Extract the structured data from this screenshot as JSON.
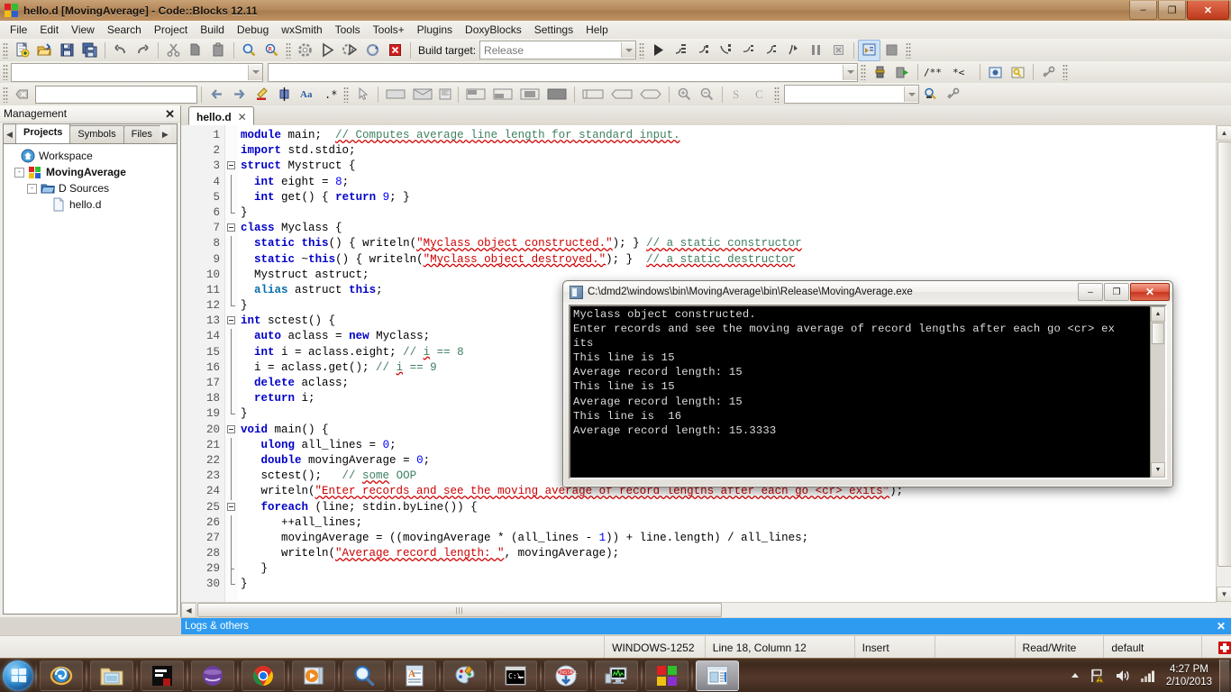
{
  "titlebar": {
    "title": "hello.d [MovingAverage] - Code::Blocks 12.11",
    "minimize": "–",
    "restore": "❐",
    "close": "✕"
  },
  "menubar": {
    "items": [
      "File",
      "Edit",
      "View",
      "Search",
      "Project",
      "Build",
      "Debug",
      "wxSmith",
      "Tools",
      "Tools+",
      "Plugins",
      "DoxyBlocks",
      "Settings",
      "Help"
    ]
  },
  "toolbar": {
    "build_target_label": "Build target:",
    "build_target_value": "Release",
    "main_icons": [
      "new-file-icon",
      "open-file-icon",
      "save-icon",
      "save-all-icon",
      "undo-icon",
      "redo-icon",
      "cut-icon",
      "copy-icon",
      "paste-icon",
      "find-icon",
      "replace-icon"
    ],
    "compile_icons": [
      "build-icon",
      "run-icon",
      "build-and-run-icon",
      "rebuild-icon",
      "abort-icon"
    ],
    "debug_icons": [
      "debug-continue-icon",
      "next-line-icon",
      "step-into-icon",
      "step-out-icon",
      "next-instruction-icon",
      "step-into-instruction-icon",
      "run-to-cursor-icon",
      "break-debugger-icon",
      "stop-debugger-icon",
      "debugging-windows-icon",
      "various-info-icon"
    ],
    "doxy_icons": [
      "doxyblocks-extract-icon",
      "doxyblocks-run-icon",
      "doxyblocks-comment-icon",
      "doxyblocks-block-comment-icon",
      "doxyblocks-preview-icon",
      "doxyblocks-help-icon",
      "doxyblocks-config-icon"
    ],
    "find_placeholder": "",
    "goto_placeholder": "",
    "search_icons": [
      "clear-icon",
      "prev-match-icon",
      "next-match-icon",
      "highlight-icon",
      "select-icon",
      "match-case-icon",
      "regex-icon"
    ],
    "wxsmith_icons": [
      "pointer-icon",
      "panel-icon",
      "dialog-icon",
      "frame-icon",
      "align-left-icon",
      "align-right-icon",
      "align-center-icon",
      "fill-icon",
      "expand-icon",
      "shrink-icon",
      "stretch-icon",
      "zoom-in-icon",
      "zoom-out-icon",
      "s-icon",
      "c-icon"
    ],
    "symbol_placeholder": ""
  },
  "management": {
    "title": "Management",
    "close": "✕",
    "tabs": [
      {
        "label": "Projects",
        "active": true
      },
      {
        "label": "Symbols",
        "active": false
      },
      {
        "label": "Files",
        "active": false
      }
    ],
    "prev_arrow": "◀",
    "next_arrow": "▶",
    "tree": [
      {
        "label": "Workspace",
        "indent": 0,
        "icon": "workspace-icon",
        "bold": false,
        "expander": ""
      },
      {
        "label": "MovingAverage",
        "indent": 1,
        "icon": "project-icon",
        "bold": true,
        "expander": "-"
      },
      {
        "label": "D Sources",
        "indent": 2,
        "icon": "folder-icon",
        "bold": false,
        "expander": "-"
      },
      {
        "label": "hello.d",
        "indent": 3,
        "icon": "file-icon",
        "bold": false,
        "expander": ""
      }
    ]
  },
  "editor": {
    "tab_label": "hello.d",
    "tab_close": "✕",
    "total_lines": 30,
    "code": [
      {
        "n": 1,
        "fold": "none",
        "html": "<span class=\"kw\">module</span> <span class=\"pln\">main;  </span><span class=\"cmt sq\">// Computes average line length for standard input.</span>"
      },
      {
        "n": 2,
        "fold": "none",
        "html": "<span class=\"kw\">import</span> <span class=\"pln\">std.stdio;</span>"
      },
      {
        "n": 3,
        "fold": "open",
        "html": "<span class=\"kw\">struct</span> <span class=\"pln\">Mystruct {</span>"
      },
      {
        "n": 4,
        "fold": "bar",
        "html": "  <span class=\"kw\">int</span> <span class=\"pln\">eight = </span><span class=\"num\">8</span><span class=\"pln\">;</span>"
      },
      {
        "n": 5,
        "fold": "bar",
        "html": "  <span class=\"kw\">int</span> <span class=\"pln\">get() { </span><span class=\"kw\">return</span> <span class=\"num\">9</span><span class=\"pln\">; }</span>"
      },
      {
        "n": 6,
        "fold": "end",
        "html": "<span class=\"pln\">}</span>"
      },
      {
        "n": 7,
        "fold": "open",
        "html": "<span class=\"kw\">class</span> <span class=\"pln\">Myclass {</span>"
      },
      {
        "n": 8,
        "fold": "bar",
        "html": "  <span class=\"kw\">static</span> <span class=\"kw\">this</span><span class=\"pln\">() { writeln(</span><span class=\"str sq\">\"Myclass object constructed.\"</span><span class=\"pln\">); } </span><span class=\"cmt sq\">// a static constructor</span>"
      },
      {
        "n": 9,
        "fold": "bar",
        "html": "  <span class=\"kw\">static</span> <span class=\"pln\">~</span><span class=\"kw\">this</span><span class=\"pln\">() { writeln(</span><span class=\"str sq\">\"Myclass object destroyed.\"</span><span class=\"pln\">); }  </span><span class=\"cmt sq\">// a static destructor</span>"
      },
      {
        "n": 10,
        "fold": "bar",
        "html": "  <span class=\"pln\">Mystruct astruct;</span>"
      },
      {
        "n": 11,
        "fold": "bar",
        "html": "  <span class=\"kw2\">alias</span> <span class=\"pln\">astruct </span><span class=\"kw\">this</span><span class=\"pln\">;</span>"
      },
      {
        "n": 12,
        "fold": "end",
        "html": "<span class=\"pln\">}</span>"
      },
      {
        "n": 13,
        "fold": "open",
        "html": "<span class=\"kw\">int</span> <span class=\"pln\">sctest() {</span>"
      },
      {
        "n": 14,
        "fold": "bar",
        "html": "  <span class=\"kw\">auto</span> <span class=\"pln\">aclass = </span><span class=\"kw\">new</span> <span class=\"pln\">Myclass;</span>"
      },
      {
        "n": 15,
        "fold": "bar",
        "html": "  <span class=\"kw\">int</span> <span class=\"pln\">i = aclass.eight; </span><span class=\"cmt\">// <span class=\"sq\">i</span> == 8</span>"
      },
      {
        "n": 16,
        "fold": "bar",
        "html": "  <span class=\"pln\">i = aclass.get(); </span><span class=\"cmt\">// <span class=\"sq\">i</span> == 9</span>"
      },
      {
        "n": 17,
        "fold": "bar",
        "html": "  <span class=\"kw\">delete</span> <span class=\"pln\">aclass;</span>"
      },
      {
        "n": 18,
        "fold": "bar",
        "html": "  <span class=\"kw\">return</span> <span class=\"pln\">i;</span>"
      },
      {
        "n": 19,
        "fold": "end",
        "html": "<span class=\"pln\">}</span>"
      },
      {
        "n": 20,
        "fold": "open",
        "html": "<span class=\"kw\">void</span> <span class=\"pln\">main() {</span>"
      },
      {
        "n": 21,
        "fold": "bar",
        "html": "   <span class=\"kw\">ulong</span> <span class=\"pln\">all_lines = </span><span class=\"num\">0</span><span class=\"pln\">;</span>"
      },
      {
        "n": 22,
        "fold": "bar",
        "html": "   <span class=\"kw\">double</span> <span class=\"pln\">movingAverage = </span><span class=\"num\">0</span><span class=\"pln\">;</span>"
      },
      {
        "n": 23,
        "fold": "bar",
        "html": "   <span class=\"pln\">sctest();   </span><span class=\"cmt\">// <span class=\"sq\">some</span> OOP</span>"
      },
      {
        "n": 24,
        "fold": "bar",
        "html": "   <span class=\"pln\">writeln(</span><span class=\"str sq\">\"Enter records and see the moving average of record lengths after each go &lt;cr&gt; exits\"</span><span class=\"pln\">);</span>"
      },
      {
        "n": 25,
        "fold": "open2",
        "html": "   <span class=\"kw\">foreach</span> <span class=\"pln\">(line; stdin.byLine()) {</span>"
      },
      {
        "n": 26,
        "fold": "bar2",
        "html": "      <span class=\"pln\">++all_lines;</span>"
      },
      {
        "n": 27,
        "fold": "bar2",
        "html": "      <span class=\"pln\">movingAverage = ((movingAverage * (all_lines - </span><span class=\"num\">1</span><span class=\"pln\">)) + line.length) / all_lines;</span>"
      },
      {
        "n": 28,
        "fold": "bar2",
        "html": "      <span class=\"pln\">writeln(</span><span class=\"str sq\">\"Average record length: \"</span><span class=\"pln\">, movingAverage);</span>"
      },
      {
        "n": 29,
        "fold": "end2",
        "html": "   <span class=\"pln\">}</span>"
      },
      {
        "n": 30,
        "fold": "end",
        "html": "<span class=\"pln\">}</span>"
      }
    ]
  },
  "console": {
    "title": "C:\\dmd2\\windows\\bin\\MovingAverage\\bin\\Release\\MovingAverage.exe",
    "minimize": "–",
    "restore": "❐",
    "close": "✕",
    "output": "Myclass object constructed.\nEnter records and see the moving average of record lengths after each go <cr> ex\nits\nThis line is 15\nAverage record length: 15\nThis line is 15\nAverage record length: 15\nThis line is  16\nAverage record length: 15.3333",
    "scroll_up": "▲",
    "scroll_down": "▼"
  },
  "logs_panel": {
    "title": "Logs & others",
    "close": "✕"
  },
  "statusbar": {
    "encoding": "WINDOWS-1252",
    "position": "Line 18, Column 12",
    "insert_mode": "Insert",
    "access": "Read/Write",
    "profile": "default",
    "readonly_icon": "readonly-indicator-icon"
  },
  "taskbar": {
    "start": "start-orb",
    "items": [
      {
        "name": "taskbar-internet-explorer",
        "icon": "internet-explorer-icon",
        "active": false
      },
      {
        "name": "taskbar-windows-explorer",
        "icon": "folder-icon",
        "active": false
      },
      {
        "name": "taskbar-editor",
        "icon": "text-editor-icon",
        "active": false
      },
      {
        "name": "taskbar-eclipse",
        "icon": "eclipse-icon",
        "active": false
      },
      {
        "name": "taskbar-chrome",
        "icon": "chrome-icon",
        "active": false
      },
      {
        "name": "taskbar-media-player",
        "icon": "media-player-icon",
        "active": false
      },
      {
        "name": "taskbar-search",
        "icon": "magnifier-icon",
        "active": false
      },
      {
        "name": "taskbar-wordpad",
        "icon": "document-icon",
        "active": false
      },
      {
        "name": "taskbar-paint",
        "icon": "palette-icon",
        "active": false
      },
      {
        "name": "taskbar-command-prompt",
        "icon": "console-icon",
        "active": false
      },
      {
        "name": "taskbar-installer",
        "icon": "installer-icon",
        "active": false
      },
      {
        "name": "taskbar-monitor",
        "icon": "performance-monitor-icon",
        "active": false
      },
      {
        "name": "taskbar-codeblocks",
        "icon": "codeblocks-icon",
        "active": false
      },
      {
        "name": "taskbar-window",
        "icon": "window-icon",
        "active": true
      }
    ],
    "tray": {
      "show_hidden": "▲",
      "network_icon": "network-warning-icon",
      "volume_icon": "volume-icon",
      "signal_icon": "signal-bars-icon",
      "time": "4:27 PM",
      "date": "2/10/2013"
    }
  },
  "colors": {
    "accent_blue": "#2e9bf0",
    "titlebar_brown": "#b58a5c",
    "taskbar_brown": "#3e2a1d",
    "console_bg": "#000000",
    "keyword": "#0000c8",
    "comment": "#3f7f5f",
    "string": "#cc0000",
    "number": "#0000ff"
  }
}
